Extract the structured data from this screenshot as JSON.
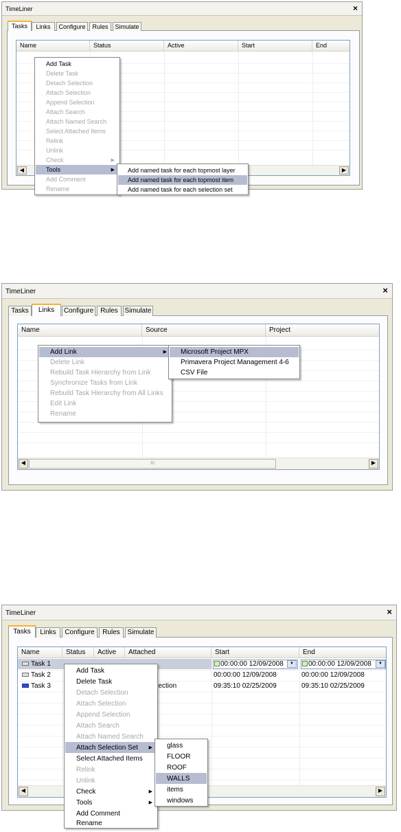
{
  "panels": [
    {
      "title": "TimeLiner",
      "close_glyph": "×",
      "tabs": [
        "Tasks",
        "Links",
        "Configure",
        "Rules",
        "Simulate"
      ],
      "selected_tab": "Tasks",
      "columns": [
        "Name",
        "Status",
        "Active",
        "Start",
        "End"
      ],
      "context_menu": [
        {
          "label": "Add Task",
          "enabled": true
        },
        {
          "label": "Delete Task",
          "enabled": false
        },
        {
          "label": "Detach Selection",
          "enabled": false
        },
        {
          "label": "Attach Selection",
          "enabled": false
        },
        {
          "label": "Append Selection",
          "enabled": false
        },
        {
          "label": "Attach Search",
          "enabled": false
        },
        {
          "label": "Attach Named Search",
          "enabled": false
        },
        {
          "label": "Select Attached Items",
          "enabled": false
        },
        {
          "label": "Relink",
          "enabled": false
        },
        {
          "label": "Unlink",
          "enabled": false
        },
        {
          "label": "Check",
          "enabled": false,
          "submenu": true
        },
        {
          "label": "Tools",
          "enabled": true,
          "submenu": true,
          "highlighted": true
        },
        {
          "label": "Add Comment",
          "enabled": false
        },
        {
          "label": "Rename",
          "enabled": false
        }
      ],
      "submenu": [
        {
          "label": "Add named task for each topmost layer"
        },
        {
          "label": "Add named task for each topmost item",
          "highlighted": true
        },
        {
          "label": "Add named task for each selection set"
        }
      ]
    },
    {
      "title": "TimeLiner",
      "close_glyph": "×",
      "tabs": [
        "Tasks",
        "Links",
        "Configure",
        "Rules",
        "Simulate"
      ],
      "selected_tab": "Links",
      "columns": [
        "Name",
        "Source",
        "Project"
      ],
      "context_menu": [
        {
          "label": "Add Link",
          "enabled": true,
          "submenu": true,
          "highlighted": true
        },
        {
          "label": "Delete Link",
          "enabled": false
        },
        {
          "label": "Rebuild Task Hierarchy from Link",
          "enabled": false
        },
        {
          "label": "Synchronize Tasks from Link",
          "enabled": false
        },
        {
          "label": "Rebuild Task Hierarchy from All Links",
          "enabled": false
        },
        {
          "label": "Edit Link",
          "enabled": false
        },
        {
          "label": "Rename",
          "enabled": false
        }
      ],
      "submenu": [
        {
          "label": "Microsoft Project MPX",
          "highlighted": true
        },
        {
          "label": "Primavera Project Management 4-6"
        },
        {
          "label": "CSV File"
        }
      ],
      "scroll_thumb": "III"
    },
    {
      "title": "TimeLiner",
      "close_glyph": "×",
      "tabs": [
        "Tasks",
        "Links",
        "Configure",
        "Rules",
        "Simulate"
      ],
      "selected_tab": "Tasks",
      "columns": [
        "Name",
        "Status",
        "Active",
        "Attached",
        "Start",
        "End"
      ],
      "rows": [
        {
          "name": "Task 1",
          "attached": "",
          "start": "00:00:00 12/09/2008",
          "end": "00:00:00 12/09/2008",
          "selected": true
        },
        {
          "name": "Task 2",
          "attached": "",
          "start": "00:00:00 12/09/2008",
          "end": "00:00:00 12/09/2008"
        },
        {
          "name": "Task 3",
          "attached": "Selection",
          "start": "09:35:10 02/25/2009",
          "end": "09:35:10 02/25/2009"
        }
      ],
      "context_menu": [
        {
          "label": "Add Task",
          "enabled": true
        },
        {
          "label": "Delete Task",
          "enabled": true
        },
        {
          "label": "Detach Selection",
          "enabled": false
        },
        {
          "label": "Attach Selection",
          "enabled": false
        },
        {
          "label": "Append Selection",
          "enabled": false
        },
        {
          "label": "Attach Search",
          "enabled": false
        },
        {
          "label": "Attach Named Search",
          "enabled": false
        },
        {
          "label": "Attach Selection Set",
          "enabled": true,
          "submenu": true,
          "highlighted": true
        },
        {
          "label": "Select Attached Items",
          "enabled": true
        },
        {
          "label": "Relink",
          "enabled": false
        },
        {
          "label": "Unlink",
          "enabled": false
        },
        {
          "label": "Check",
          "enabled": true,
          "submenu": true
        },
        {
          "label": "Tools",
          "enabled": true,
          "submenu": true
        },
        {
          "label": "Add Comment",
          "enabled": true
        },
        {
          "label": "Rename",
          "enabled": true
        }
      ],
      "submenu": [
        {
          "label": "glass"
        },
        {
          "label": "FLOOR"
        },
        {
          "label": "ROOF"
        },
        {
          "label": "WALLS",
          "highlighted": true
        },
        {
          "label": "items"
        },
        {
          "label": "windows"
        }
      ]
    }
  ],
  "colors": {
    "active_tab_accent": "#f9b233",
    "menu_highlight": "#b6bdd2",
    "disabled_text": "#a7a6aa"
  }
}
